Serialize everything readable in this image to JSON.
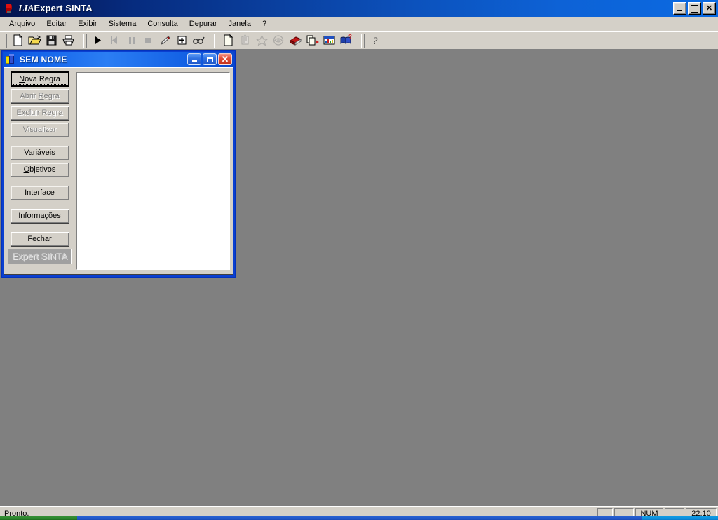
{
  "window": {
    "title_prefix": "LIA",
    "title": "Expert SINTA",
    "icon": "red-lightbulb-icon",
    "controls": {
      "minimize": "Minimizar",
      "restore": "Restaurar",
      "close": "Fechar"
    }
  },
  "menu": {
    "items": [
      {
        "label": "Arquivo",
        "accel": "A"
      },
      {
        "label": "Editar",
        "accel": "E"
      },
      {
        "label": "Exibir",
        "accel": "b"
      },
      {
        "label": "Sistema",
        "accel": "S"
      },
      {
        "label": "Consulta",
        "accel": "C"
      },
      {
        "label": "Depurar",
        "accel": "D"
      },
      {
        "label": "Janela",
        "accel": "J"
      },
      {
        "label": "?",
        "accel": "?"
      }
    ]
  },
  "toolbar": {
    "groups": [
      {
        "buttons": [
          {
            "name": "new-file-icon",
            "tip": "Novo",
            "enabled": true
          },
          {
            "name": "open-folder-icon",
            "tip": "Abrir",
            "enabled": true
          },
          {
            "name": "save-disk-icon",
            "tip": "Salvar",
            "enabled": true
          },
          {
            "name": "print-icon",
            "tip": "Imprimir",
            "enabled": true
          }
        ]
      },
      {
        "buttons": [
          {
            "name": "run-play-icon",
            "tip": "Executar",
            "enabled": true
          },
          {
            "name": "step-back-icon",
            "tip": "Voltar",
            "enabled": false
          },
          {
            "name": "pause-icon",
            "tip": "Pausar",
            "enabled": false
          },
          {
            "name": "stop-icon",
            "tip": "Parar",
            "enabled": false
          },
          {
            "name": "pencil-icon",
            "tip": "Editar",
            "enabled": true
          },
          {
            "name": "breakpoint-icon",
            "tip": "Ponto de parada",
            "enabled": true
          },
          {
            "name": "glasses-watch-icon",
            "tip": "Observar",
            "enabled": true
          }
        ]
      },
      {
        "buttons": [
          {
            "name": "new-rule-icon",
            "tip": "Nova Regra",
            "enabled": true
          },
          {
            "name": "variables-icon",
            "tip": "Variáveis",
            "enabled": false
          },
          {
            "name": "objectives-icon",
            "tip": "Objetivos",
            "enabled": false
          },
          {
            "name": "interface-icon",
            "tip": "Interface",
            "enabled": false
          },
          {
            "name": "knowledge-base-icon",
            "tip": "Base de conhecimento",
            "enabled": true
          },
          {
            "name": "copy-forward-icon",
            "tip": "Copiar",
            "enabled": true
          },
          {
            "name": "report-window-icon",
            "tip": "Relatório",
            "enabled": true
          },
          {
            "name": "book-help-icon",
            "tip": "Ajuda do livro",
            "enabled": true
          }
        ]
      },
      {
        "buttons": [
          {
            "name": "help-question-icon",
            "tip": "Ajuda",
            "enabled": true
          }
        ]
      }
    ]
  },
  "child_window": {
    "title": "SEM NOME",
    "icon": "knowledge-base-icon",
    "controls": {
      "minimize": "Minimizar",
      "maximize": "Maximizar",
      "close": "Fechar"
    },
    "buttons": [
      {
        "label": "Nova Regra",
        "accel": "N",
        "enabled": true,
        "default": true
      },
      {
        "label": "Abrir Regra",
        "accel": "R",
        "enabled": false,
        "default": false
      },
      {
        "label": "Excluir Regra",
        "accel": "",
        "enabled": false,
        "default": false
      },
      {
        "label": "Visualizar",
        "accel": "",
        "enabled": false,
        "default": false
      },
      {
        "label": "Variáveis",
        "accel": "a",
        "enabled": true,
        "default": false
      },
      {
        "label": "Objetivos",
        "accel": "O",
        "enabled": true,
        "default": false
      },
      {
        "label": "Interface",
        "accel": "I",
        "enabled": true,
        "default": false
      },
      {
        "label": "Informações",
        "accel": "ç",
        "enabled": true,
        "default": false
      },
      {
        "label": "Fechar",
        "accel": "F",
        "enabled": true,
        "default": false
      }
    ],
    "watermark": "Expert SINTA",
    "rule_list": {
      "items": [],
      "empty": true
    }
  },
  "status_bar": {
    "message": "Pronto.",
    "panes": [
      {
        "name": "pane-blank-1",
        "text": ""
      },
      {
        "name": "pane-blank-2",
        "text": ""
      },
      {
        "name": "pane-num-lock",
        "text": "NUM"
      },
      {
        "name": "pane-blank-3",
        "text": ""
      },
      {
        "name": "pane-clock",
        "text": "22:10"
      }
    ]
  },
  "colors": {
    "desktop": "#808080",
    "face": "#d4d0c8",
    "title_start": "#04134d",
    "title_end": "#0b6ae2",
    "child_title": "#2b7ef4",
    "close_red": "#e4503a",
    "list_bg": "#ffffff"
  }
}
